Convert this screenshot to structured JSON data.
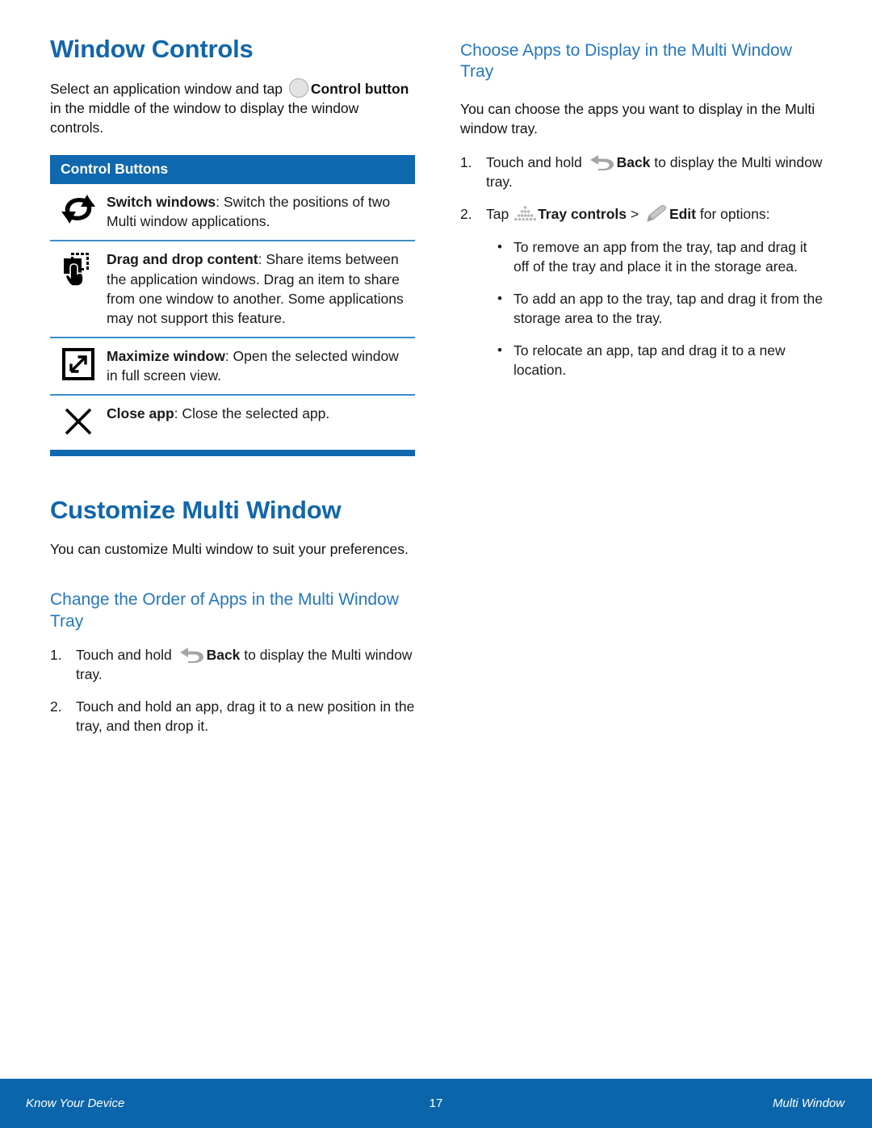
{
  "left_column": {
    "section_title": "Window Controls",
    "intro": {
      "part1": "Select an application window and tap ",
      "bold1": "Control button",
      "part2": " in the middle of the window to display the window controls."
    },
    "table": {
      "header": "Control Buttons",
      "rows": [
        {
          "icon": "switch-windows-icon",
          "term": "Switch windows",
          "desc": ": Switch the positions of two Multi window applications."
        },
        {
          "icon": "drag-and-drop-icon",
          "term": "Drag and drop content",
          "desc": ": Share items between the application windows. Drag an item to share from one window to another. Some applications may not support this feature."
        },
        {
          "icon": "maximize-window-icon",
          "term": "Maximize window",
          "desc": ": Open the selected window in full screen view."
        },
        {
          "icon": "close-app-icon",
          "term": "Close app",
          "desc": ": Close the selected app."
        }
      ]
    },
    "section_title_2": "Customize Multi Window",
    "intro_2": "You can customize Multi window to suit your preferences.",
    "sub_title": "Change the Order of Apps in the Multi Window Tray",
    "steps": [
      {
        "num": "1.",
        "text_before": "Touch and hold ",
        "icon": "back-icon",
        "bold": "Back",
        "text_after": " to display the Multi window tray."
      },
      {
        "num": "2.",
        "text_before": "Touch and hold an app, drag it to a new position in the tray, and then drop it.",
        "icon": "",
        "bold": "",
        "text_after": ""
      }
    ]
  },
  "right_column": {
    "sub_title": "Choose Apps to Display in the Multi Window Tray",
    "intro": "You can choose the apps you want to display in the Multi window tray.",
    "step1": {
      "num": "1.",
      "text_before": "Touch and hold ",
      "icon": "back-icon",
      "bold": "Back",
      "text_after": " to display the Multi window tray."
    },
    "step2": {
      "num": "2.",
      "text_before": "Tap ",
      "icon1": "tray-controls-icon",
      "bold1": "Tray controls",
      "separator": " > ",
      "icon2": "edit-pencil-icon",
      "bold2": "Edit",
      "text_after": " for options:"
    },
    "bullets": [
      "To remove an app from the tray, tap and drag it off of the tray and place it in the storage area.",
      "To add an app to the tray, tap and drag it from the storage area to the tray.",
      "To relocate an app, tap and drag it to a new location."
    ],
    "bullet_glyph": "•"
  },
  "footer": {
    "left": "Know Your Device",
    "page_number": "17",
    "right": "Multi Window"
  },
  "colors": {
    "heading_blue": "#1266ab",
    "subheading_blue": "#2477c0",
    "table_header_blue": "#1068ae",
    "rule_blue": "#3c8dc8",
    "footer_blue": "#0a65ab"
  }
}
